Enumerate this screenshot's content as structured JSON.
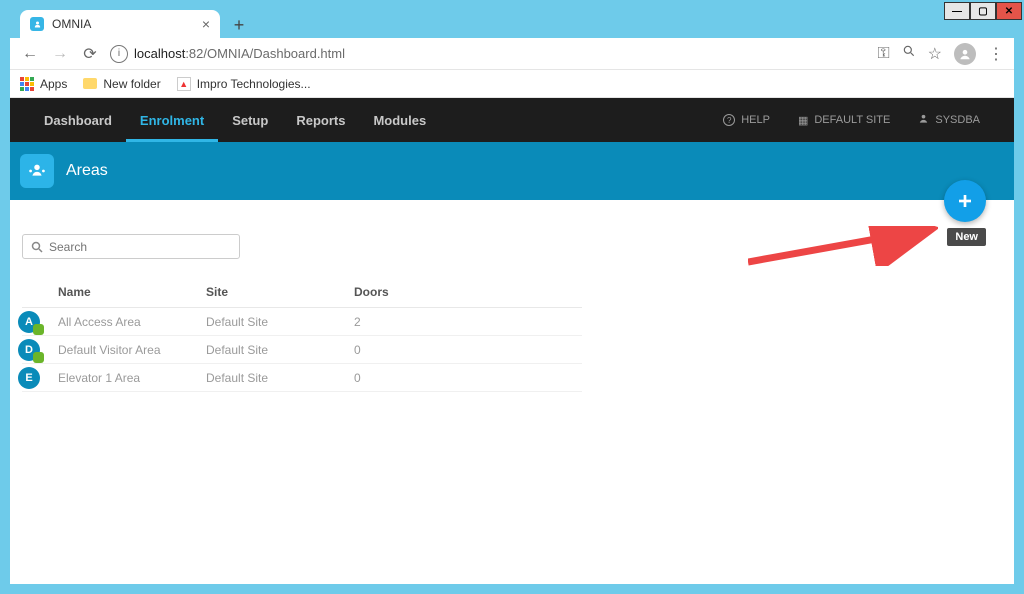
{
  "window": {
    "tab_title": "OMNIA",
    "url_host": "localhost",
    "url_port": ":82",
    "url_path": "/OMNIA/Dashboard.html"
  },
  "bookmarks": {
    "apps": "Apps",
    "new_folder": "New folder",
    "impro": "Impro Technologies..."
  },
  "nav": {
    "items": [
      "Dashboard",
      "Enrolment",
      "Setup",
      "Reports",
      "Modules"
    ],
    "help": "HELP",
    "site": "DEFAULT SITE",
    "user": "SYSDBA"
  },
  "page": {
    "title": "Areas",
    "fab_tooltip": "New",
    "search_placeholder": "Search"
  },
  "table": {
    "headers": {
      "name": "Name",
      "site": "Site",
      "doors": "Doors"
    },
    "rows": [
      {
        "avatar": "A",
        "default": true,
        "name": "All Access Area",
        "site": "Default Site",
        "doors": "2"
      },
      {
        "avatar": "D",
        "default": true,
        "name": "Default Visitor Area",
        "site": "Default Site",
        "doors": "0"
      },
      {
        "avatar": "E",
        "default": false,
        "name": "Elevator 1 Area",
        "site": "Default Site",
        "doors": "0"
      }
    ]
  }
}
